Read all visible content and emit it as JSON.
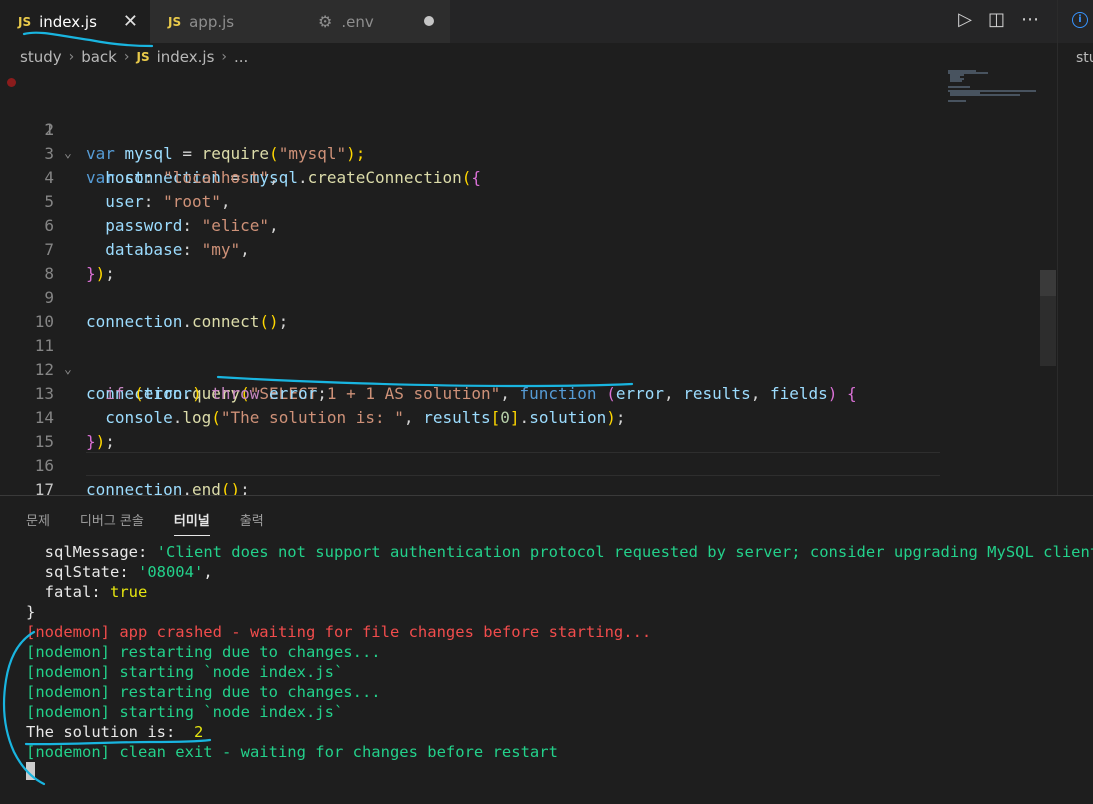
{
  "tabs": [
    {
      "icon": "JS",
      "label": "index.js",
      "active": true
    },
    {
      "icon": "JS",
      "label": "app.js",
      "active": false
    },
    {
      "icon": "gear-icon",
      "label": ".env",
      "active": false,
      "modified": true
    }
  ],
  "right_panel": {
    "label": "stu"
  },
  "breadcrumb": [
    "study",
    "back",
    "index.js",
    "..."
  ],
  "editor": {
    "lines": [
      {
        "n": "1"
      },
      {
        "n": "2"
      },
      {
        "n": "3"
      },
      {
        "n": "4"
      },
      {
        "n": "5"
      },
      {
        "n": "6"
      },
      {
        "n": "7"
      },
      {
        "n": "8"
      },
      {
        "n": "9"
      },
      {
        "n": "10"
      },
      {
        "n": "11"
      },
      {
        "n": "12"
      },
      {
        "n": "13"
      },
      {
        "n": "14"
      },
      {
        "n": "15"
      },
      {
        "n": "16"
      },
      {
        "n": "17"
      }
    ],
    "code": {
      "l1": [
        "var",
        " mysql",
        " = ",
        "require",
        "(",
        "\"mysql\"",
        ");"
      ],
      "l2": [
        "var",
        " connection",
        " = ",
        "mysql",
        ".",
        "createConnection",
        "(",
        "{"
      ],
      "l3": [
        "  host",
        ": ",
        "\"localhost\"",
        ","
      ],
      "l4": [
        "  user",
        ": ",
        "\"root\"",
        ","
      ],
      "l5": [
        "  password",
        ": ",
        "\"elice\"",
        ","
      ],
      "l6": [
        "  database",
        ": ",
        "\"my\"",
        ","
      ],
      "l7": [
        "}",
        ")",
        ";"
      ],
      "l9": [
        "connection",
        ".",
        "connect",
        "()",
        ";"
      ],
      "l11": [
        "connection",
        ".",
        "query",
        "(",
        "\"SELECT 1 + 1 AS solution\"",
        ", ",
        "function",
        " (",
        "error",
        ", ",
        "results",
        ", ",
        "fields",
        ") ",
        "{"
      ],
      "l12": [
        "  if",
        " (",
        "error",
        ") ",
        "throw",
        " error",
        ";"
      ],
      "l13": [
        "  console",
        ".",
        "log",
        "(",
        "\"The solution is: \"",
        ", ",
        "results",
        "[",
        "0",
        "]",
        ".",
        "solution",
        ")",
        ";"
      ],
      "l14": [
        "}",
        ")",
        ";"
      ],
      "l16": [
        "connection",
        ".",
        "end",
        "()",
        ";"
      ]
    }
  },
  "panel": {
    "tabs": [
      "문제",
      "디버그 콘솔",
      "터미널",
      "출력"
    ],
    "active_tab": "터미널",
    "terminal": {
      "t1": [
        "  sqlMessage: ",
        "'Client does not support authentication protocol requested by server; consider upgrading MySQL client'",
        ","
      ],
      "t2": [
        "  sqlState: ",
        "'08004'",
        ","
      ],
      "t3": [
        "  fatal: ",
        "true"
      ],
      "t4": "}",
      "t5": "[nodemon] app crashed - waiting for file changes before starting...",
      "t6": "[nodemon] restarting due to changes...",
      "t7": "[nodemon] starting `node index.js`",
      "t8": "[nodemon] restarting due to changes...",
      "t9": "[nodemon] starting `node index.js`",
      "t10": [
        "The solution is: ",
        " 2"
      ],
      "t11": "[nodemon] clean exit - waiting for changes before restart"
    }
  },
  "colors": {
    "accent": "#3794ff",
    "annotation": "#19b5e0",
    "keyword": "#569cd6",
    "string": "#ce9178",
    "terminal_green": "#23d18b",
    "terminal_red": "#f14c4c"
  }
}
